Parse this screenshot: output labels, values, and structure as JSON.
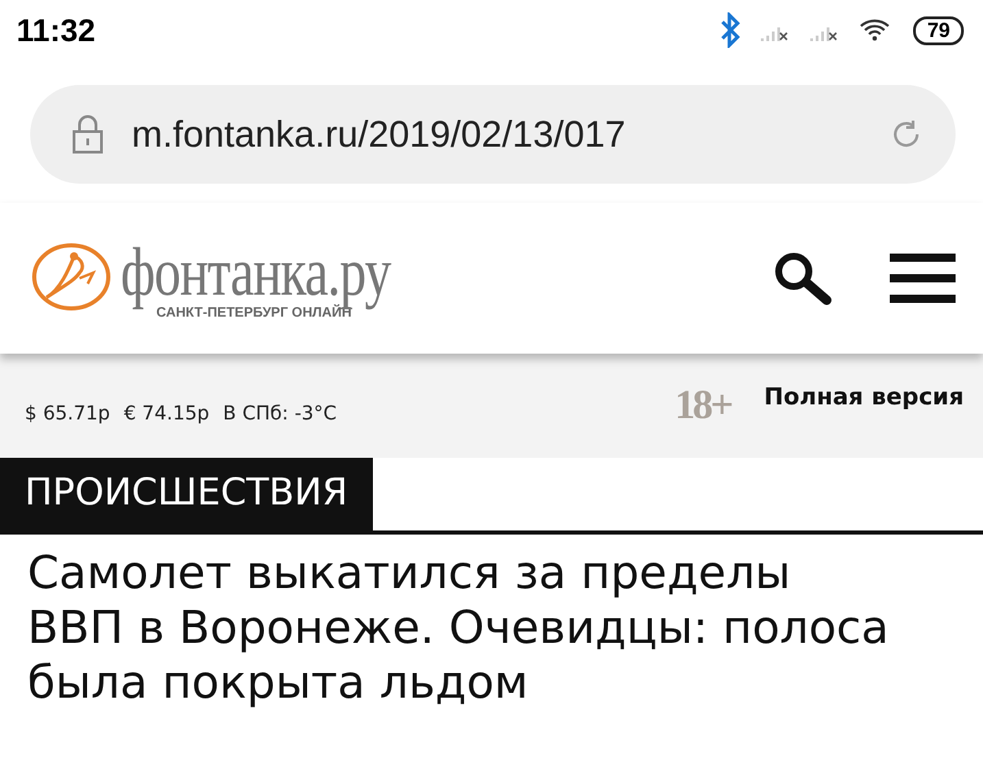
{
  "status_bar": {
    "time": "11:32",
    "battery": "79"
  },
  "address_bar": {
    "url": "m.fontanka.ru/2019/02/13/017"
  },
  "header": {
    "logo_title": "фонтанка.ру",
    "logo_subtitle": "САНКТ-ПЕТЕРБУРГ ОНЛАЙН"
  },
  "info_bar": {
    "items": [
      "$ 65.71р",
      "€ 74.15р",
      "В СПб: -3°C"
    ],
    "age_rating": "18+",
    "full_version_link": "Полная версия"
  },
  "article": {
    "category": "ПРОИСШЕСТВИЯ",
    "headline": "Самолет выкатился за пределы ВВП в Воронеже. Очевидцы: полоса была покрыта льдом"
  }
}
